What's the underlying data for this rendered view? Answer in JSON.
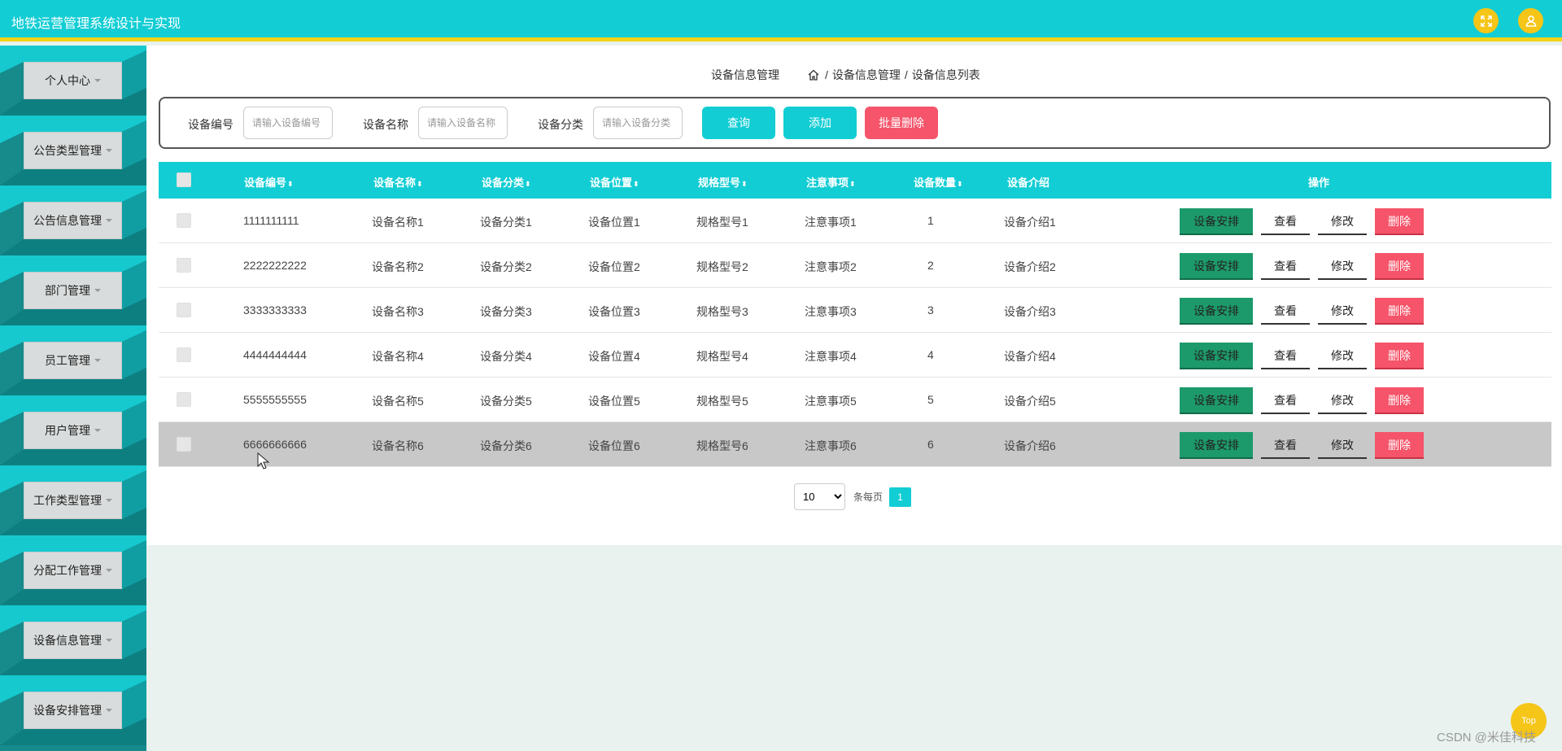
{
  "header": {
    "title": "地铁运营管理系统设计与实现",
    "fullscreen_icon": "fullscreen-icon",
    "user_icon": "user-icon"
  },
  "sidebar": {
    "items": [
      {
        "label": "个人中心"
      },
      {
        "label": "公告类型管理"
      },
      {
        "label": "公告信息管理"
      },
      {
        "label": "部门管理"
      },
      {
        "label": "员工管理"
      },
      {
        "label": "用户管理"
      },
      {
        "label": "工作类型管理"
      },
      {
        "label": "分配工作管理"
      },
      {
        "label": "设备信息管理"
      },
      {
        "label": "设备安排管理"
      }
    ]
  },
  "breadcrumb": {
    "page_title": "设备信息管理",
    "sep": "/",
    "level1": "设备信息管理",
    "level2": "设备信息列表"
  },
  "search": {
    "code_label": "设备编号",
    "code_placeholder": "请输入设备编号",
    "name_label": "设备名称",
    "name_placeholder": "请输入设备名称",
    "category_label": "设备分类",
    "category_placeholder": "请输入设备分类",
    "query_button": "查询",
    "add_button": "添加",
    "batch_delete_button": "批量删除"
  },
  "table": {
    "sort_glyph": "⬍",
    "columns": [
      "设备编号",
      "设备名称",
      "设备分类",
      "设备位置",
      "规格型号",
      "注意事项",
      "设备数量",
      "设备介绍",
      "操作"
    ],
    "rows": [
      {
        "code": "1111111111",
        "name": "设备名称1",
        "category": "设备分类1",
        "location": "设备位置1",
        "model": "规格型号1",
        "notes": "注意事项1",
        "qty": "1",
        "intro": "设备介绍1"
      },
      {
        "code": "2222222222",
        "name": "设备名称2",
        "category": "设备分类2",
        "location": "设备位置2",
        "model": "规格型号2",
        "notes": "注意事项2",
        "qty": "2",
        "intro": "设备介绍2"
      },
      {
        "code": "3333333333",
        "name": "设备名称3",
        "category": "设备分类3",
        "location": "设备位置3",
        "model": "规格型号3",
        "notes": "注意事项3",
        "qty": "3",
        "intro": "设备介绍3"
      },
      {
        "code": "4444444444",
        "name": "设备名称4",
        "category": "设备分类4",
        "location": "设备位置4",
        "model": "规格型号4",
        "notes": "注意事项4",
        "qty": "4",
        "intro": "设备介绍4"
      },
      {
        "code": "5555555555",
        "name": "设备名称5",
        "category": "设备分类5",
        "location": "设备位置5",
        "model": "规格型号5",
        "notes": "注意事项5",
        "qty": "5",
        "intro": "设备介绍5"
      },
      {
        "code": "6666666666",
        "name": "设备名称6",
        "category": "设备分类6",
        "location": "设备位置6",
        "model": "规格型号6",
        "notes": "注意事项6",
        "qty": "6",
        "intro": "设备介绍6"
      }
    ],
    "actions": {
      "arrange": "设备安排",
      "view": "查看",
      "edit": "修改",
      "delete": "删除"
    }
  },
  "pagination": {
    "page_size": "10",
    "page_size_options": [
      "10"
    ],
    "per_page_label": "条每页",
    "current_page": "1"
  },
  "back_to_top": "Top",
  "watermark": "CSDN @米佳科技",
  "colors": {
    "accent": "#12cdd4",
    "header_border": "#f2d318",
    "sidebar_bg": "#178a8c",
    "delete": "#f5546a",
    "arrange": "#1d9a6b",
    "icon_button": "#f5c518"
  }
}
